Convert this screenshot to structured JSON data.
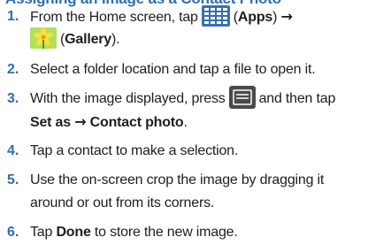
{
  "heading": "Assigning an Image as a Contact Photo",
  "steps": [
    {
      "number": "1.",
      "line1_a": "From the Home screen, tap",
      "line1_apps_open": "(",
      "line1_apps": "Apps",
      "line1_apps_close": ")",
      "line1_arrow": "→",
      "line2_open": "(",
      "line2_gallery": "Gallery",
      "line2_close": ")."
    },
    {
      "number": "2.",
      "text": "Select a folder location and tap a file to open it."
    },
    {
      "number": "3.",
      "line1_a": "With the image displayed, press",
      "line1_b": "and then tap",
      "line2_setas": "Set as",
      "line2_arrow": "→",
      "line2_contact": "Contact photo",
      "line2_end": "."
    },
    {
      "number": "4.",
      "text": "Tap a contact to make a selection."
    },
    {
      "number": "5.",
      "line1": "Use the on-screen crop the image by dragging it",
      "line2": "around or out from its corners."
    },
    {
      "number": "6.",
      "line_a": "Tap",
      "line_done": "Done",
      "line_b": "to store the new image."
    }
  ],
  "icons": {
    "apps": "apps-grid-icon",
    "gallery": "gallery-icon",
    "menu": "menu-key-icon"
  },
  "colors": {
    "accent": "#2f6db3",
    "text": "#1e1e1e",
    "apps_icon": "#3a6fb0",
    "menu_icon": "#4a4a4a"
  }
}
